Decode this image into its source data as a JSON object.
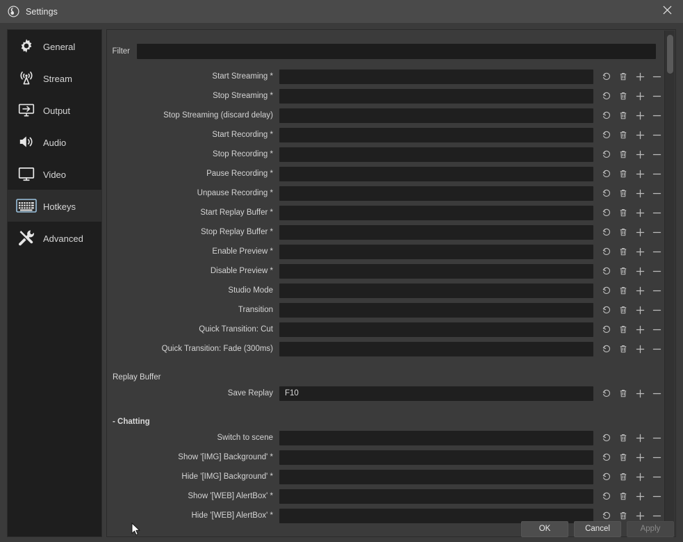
{
  "window": {
    "title": "Settings",
    "app_icon": "obs-logo-icon",
    "close_icon": "close-icon"
  },
  "sidebar": {
    "items": [
      {
        "label": "General",
        "icon": "gear-icon",
        "selected": false
      },
      {
        "label": "Stream",
        "icon": "broadcast-icon",
        "selected": false
      },
      {
        "label": "Output",
        "icon": "output-icon",
        "selected": false
      },
      {
        "label": "Audio",
        "icon": "speaker-icon",
        "selected": false
      },
      {
        "label": "Video",
        "icon": "monitor-icon",
        "selected": false
      },
      {
        "label": "Hotkeys",
        "icon": "keyboard-icon",
        "selected": true
      },
      {
        "label": "Advanced",
        "icon": "tools-icon",
        "selected": false
      }
    ]
  },
  "filter": {
    "label": "Filter",
    "value": "",
    "placeholder": ""
  },
  "actions": {
    "revert": "revert-icon",
    "delete": "trash-icon",
    "add": "plus-icon",
    "remove": "minus-icon"
  },
  "hotkeys": {
    "sections": [
      {
        "heading": "",
        "heading_bold": false,
        "rows": [
          {
            "label": "Start Streaming",
            "star": true,
            "value": ""
          },
          {
            "label": "Stop Streaming",
            "star": true,
            "value": ""
          },
          {
            "label": "Stop Streaming (discard delay)",
            "star": false,
            "value": ""
          },
          {
            "label": "Start Recording",
            "star": true,
            "value": ""
          },
          {
            "label": "Stop Recording",
            "star": true,
            "value": ""
          },
          {
            "label": "Pause Recording",
            "star": true,
            "value": ""
          },
          {
            "label": "Unpause Recording",
            "star": true,
            "value": ""
          },
          {
            "label": "Start Replay Buffer",
            "star": true,
            "value": ""
          },
          {
            "label": "Stop Replay Buffer",
            "star": true,
            "value": ""
          },
          {
            "label": "Enable Preview",
            "star": true,
            "value": ""
          },
          {
            "label": "Disable Preview",
            "star": true,
            "value": ""
          },
          {
            "label": "Studio Mode",
            "star": false,
            "value": ""
          },
          {
            "label": "Transition",
            "star": false,
            "value": ""
          },
          {
            "label": "Quick Transition: Cut",
            "star": false,
            "value": ""
          },
          {
            "label": "Quick Transition: Fade (300ms)",
            "star": false,
            "value": ""
          }
        ]
      },
      {
        "heading": "Replay Buffer",
        "heading_bold": false,
        "rows": [
          {
            "label": "Save Replay",
            "star": false,
            "value": "F10"
          }
        ]
      },
      {
        "heading": "- Chatting",
        "heading_bold": true,
        "rows": [
          {
            "label": "Switch to scene",
            "star": false,
            "value": ""
          },
          {
            "label": "Show '[IMG] Background'",
            "star": true,
            "value": ""
          },
          {
            "label": "Hide '[IMG] Background'",
            "star": true,
            "value": ""
          },
          {
            "label": "Show '[WEB] AlertBox'",
            "star": true,
            "value": ""
          },
          {
            "label": "Hide '[WEB] AlertBox'",
            "star": true,
            "value": ""
          }
        ]
      }
    ]
  },
  "footer": {
    "ok": "OK",
    "cancel": "Cancel",
    "apply": "Apply",
    "apply_disabled": true
  },
  "colors": {
    "window_bg": "#3b3b3b",
    "titlebar_bg": "#4a4a4a",
    "sidebar_bg": "#1e1e1e",
    "sidebar_selected": "#2d2d2d",
    "input_bg": "#1f1f1f",
    "text": "#d4d4d4"
  }
}
